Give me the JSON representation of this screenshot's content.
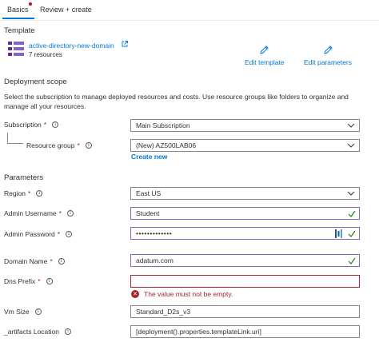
{
  "tabs": [
    {
      "label": "Basics",
      "active": true
    },
    {
      "label": "Review + create",
      "active": false
    }
  ],
  "template": {
    "section_title": "Template",
    "name": "active-directory-new-domain",
    "resources": "7 resources",
    "edit_template": "Edit template",
    "edit_parameters": "Edit parameters"
  },
  "deployment_scope": {
    "section_title": "Deployment scope",
    "description": "Select the subscription to manage deployed resources and costs. Use resource groups like folders to organize and manage all your resources.",
    "subscription_label": "Subscription",
    "subscription_value": "Main Subscription",
    "resource_group_label": "Resource group",
    "resource_group_value": "(New) AZ500LAB06",
    "create_new": "Create new"
  },
  "parameters": {
    "section_title": "Parameters",
    "region_label": "Region",
    "region_value": "East US",
    "admin_username_label": "Admin Username",
    "admin_username_value": "Student",
    "admin_password_label": "Admin Password",
    "admin_password_value": "•••••••••••••",
    "domain_name_label": "Domain Name",
    "domain_name_value": "adatum.com",
    "dns_prefix_label": "Dns Prefix",
    "dns_prefix_value": "",
    "dns_prefix_error": "The value must not be empty.",
    "vm_size_label": "Vm Size",
    "vm_size_value": "Standard_D2s_v3",
    "artifacts_location_label": "_artifacts Location",
    "artifacts_location_value": "[deployment().properties.templateLink.uri]"
  },
  "colors": {
    "accent": "#0078d4",
    "required": "#a4262c",
    "valid_border": "#8764b8",
    "valid_check": "#107c10",
    "template_icon": "#5c2d91"
  },
  "icons": [
    "template-icon",
    "external-link-icon",
    "pencil-icon",
    "chevron-down-icon",
    "info-icon",
    "checkmark-icon",
    "password-manager-icon",
    "error-icon"
  ]
}
